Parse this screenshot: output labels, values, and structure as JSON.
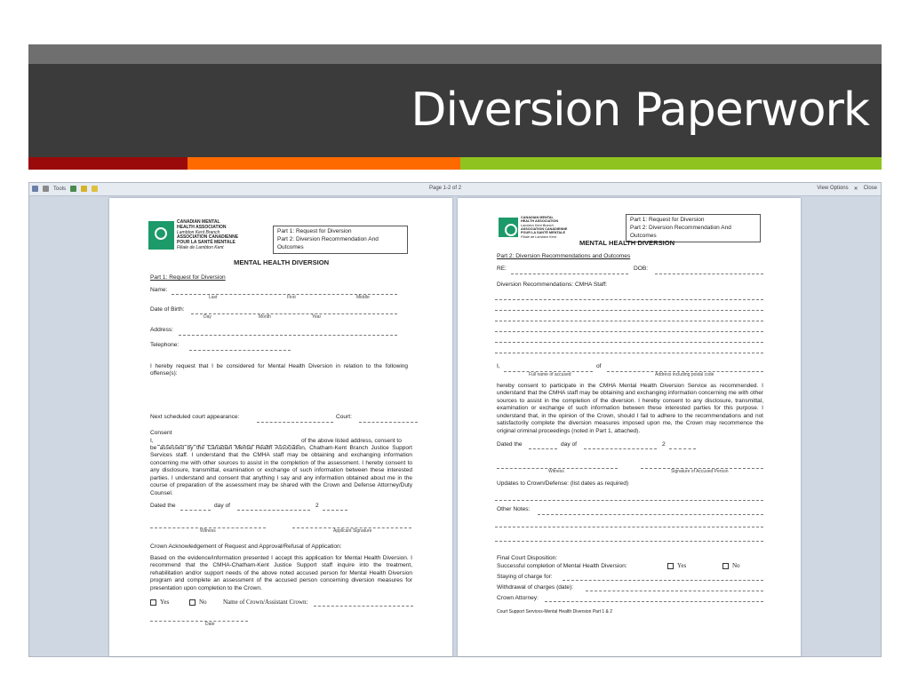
{
  "slide": {
    "title": "Diversion Paperwork"
  },
  "colors": {
    "bar1": "#9b0a0a",
    "bar2": "#ff6a00",
    "bar3": "#8fc31f",
    "title_bg": "#3b3b3b"
  },
  "toolbar": {
    "tools": "Tools",
    "page_indicator": "Page 1-2 of 2",
    "view_options": "View Options",
    "close": "Close"
  },
  "logo": {
    "line1": "CANADIAN MENTAL",
    "line2": "HEALTH ASSOCIATION",
    "line3": "Lambton Kent Branch",
    "line4": "ASSOCIATION CANADIENNE",
    "line5": "POUR LA SANTÉ MENTALE",
    "line6": "Filiale de Lambton Kent"
  },
  "page1": {
    "box_line1": "Part 1: Request for Diversion",
    "box_line2": "Part 2: Diversion Recommendation And Outcomes",
    "heading": "MENTAL HEALTH DIVERSION",
    "part_title": "Part 1: Request for Diversion",
    "name_label": "Name:",
    "name_last": "Last",
    "name_first": "First",
    "name_middle": "Middle",
    "dob_label": "Date of Birth:",
    "dob_day": "Day",
    "dob_month": "Month",
    "dob_year": "Year",
    "address_label": "Address:",
    "telephone_label": "Telephone:",
    "request_text": "I hereby request that I be considered for Mental Health Diversion in relation to the following offense(s):",
    "court_label": "Next scheduled court appearance:",
    "court_label2": "Court:",
    "consent_heading": "Consent",
    "consent_i": "I,",
    "consent_tail": "of the above listed address, consent to",
    "consent_text": "be assessed by the Canadian Mental Health Association, Chatham-Kent Branch Justice Support Services staff. I understand that the CMHA staff may be obtaining and exchanging information concerning me with other sources to assist in the completion of the assessment. I hereby consent to any disclosure, transmittal, examination or exchange of such information between these interested parties. I understand and consent that anything I say and any information obtained about me in the course of preparation of the assessment may be shared with the Crown and Defense Attorney/Duty Counsel.",
    "dated_the": "Dated the",
    "day_of": "day of",
    "year_prefix": "2",
    "witness": "Witness",
    "applicant_signature": "Applicant Signature",
    "crown_heading": "Crown Acknowledgement of Request and Approval/Refusal of Application:",
    "crown_text": "Based on the evidence/information presented I accept this application for Mental Health Diversion. I recommend that the CMHA-Chatham-Kent Justice Support staff inquire into the treatment, rehabilitation and/or support needs of the above noted accused person for Mental Health Diversion program and complete an assessment of the accused person concerning diversion measures for presentation upon completion to the Crown.",
    "yes": "Yes",
    "no": "No",
    "crown_name": "Name of Crown/Assistant Crown:",
    "date_label": "Date"
  },
  "page2": {
    "box_line1": "Part 1: Request for Diversion",
    "box_line2": "Part 2: Diversion Recommendation And Outcomes",
    "heading": "MENTAL HEALTH DIVERSION",
    "part_title": "Part 2: Diversion Recommendations and Outcomes",
    "re_label": "RE:",
    "dob_label": "DOB:",
    "rec_label": "Diversion Recommendations:  CMHA Staff:",
    "i_label": "I,",
    "of_label": "of",
    "full_name": "Full name of accused",
    "address_postal": "Address including postal code",
    "consent_text": "hereby consent to participate in the CMHA Mental Health Diversion Service as recommended. I understand that the CMHA staff may be obtaining and exchanging information concerning me with other sources to assist in the completion of the diversion. I hereby consent to any disclosure, transmittal, examination or exchange of such information between these interested parties for this purpose. I understand that, in the opinion of the Crown, should I fail to adhere to the recommendations and not satisfactorily complete the diversion measures imposed upon me, the Crown may recommence the original criminal proceedings (noted in Part 1, attached).",
    "dated_the": "Dated the",
    "day_of": "day of",
    "year_prefix": "2",
    "witness": "Witness",
    "accused_signature": "Signature of Accused Person",
    "updates_label": "Updates to Crown/Defense: (list dates as required)",
    "other_notes": "Other Notes:",
    "final_label": "Final Court Disposition:",
    "success_label": "Successful completion of Mental Health Diversion:",
    "yes": "Yes",
    "no": "No",
    "staying_label": "Staying of charge for:",
    "withdrawal_label": "Withdrawal of charges (date):",
    "crown_attorney": "Crown Attorney:",
    "footer": "Court Support Services-Mental Health Diversion Part 1 & 2"
  }
}
